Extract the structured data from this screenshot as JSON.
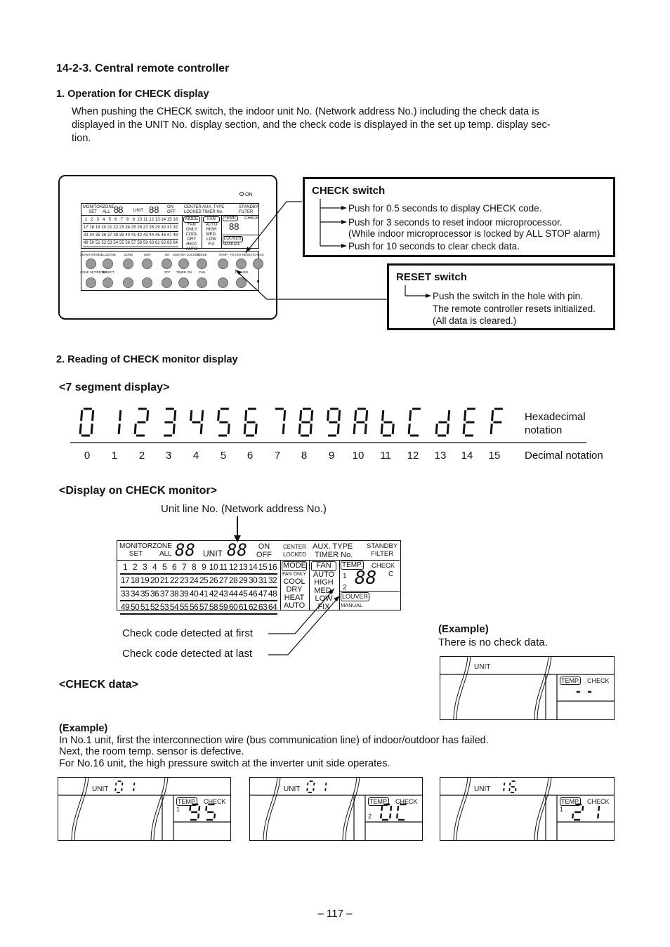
{
  "section_title": "14-2-3.  Central remote controller",
  "sub1": {
    "title": "1.  Operation for CHECK display",
    "body_line1": "When pushing the CHECK switch, the indoor unit No. (Network address No.) including the check data is",
    "body_line2": "displayed in the UNIT No. display section, and the check code is displayed in the set up temp. display sec-",
    "body_line3": "tion."
  },
  "controller": {
    "on_label": "ON",
    "lcd": {
      "monitor": "MONITOR",
      "set": "SET",
      "zone": "ZONE",
      "all": "ALL",
      "unit": "UNIT",
      "on": "ON",
      "off": "OFF",
      "center": "CENTER",
      "locked": "LOCKED",
      "aux_type": "AUX. TYPE",
      "timer_no": "TIMER No.",
      "standby": "STANDBY",
      "filter": "FILTER",
      "mode": "MODE",
      "fan_only": "FAN ONLY",
      "cool": "COOL",
      "dry": "DRY",
      "heat": "HEAT",
      "auto": "AUTO",
      "fan": "FAN",
      "fan_auto": "AUTO",
      "high": "HIGH",
      "med": "MED.",
      "low": "LOW",
      "fix": "FIX",
      "temp": "TEMP.",
      "check": "CHECK",
      "c": "C",
      "row1": "1",
      "row2": "2",
      "louver": "LOUVER",
      "manual": "MANUAL",
      "digits_placeholder": "88"
    },
    "buttons_top": [
      "MONITOR/SET",
      "ALL/ZONE",
      "ZONE",
      "UNIT",
      "ON",
      "CENTER LOCKED",
      "MODE",
      "TEMP.",
      "FILTER RESET",
      "CHECK"
    ],
    "buttons_bottom": [
      "ZONE SET/ENTER",
      "SELECT",
      "",
      "",
      "OFF",
      "TIMER ON",
      "FAN",
      "",
      "LOUVER",
      ""
    ]
  },
  "check_switch": {
    "title": "CHECK switch",
    "items": [
      "Push for 0.5 seconds to display CHECK code.",
      "Push for 3 seconds to reset indoor microprocessor.",
      "(While indoor microprocessor is locked by ALL STOP alarm)",
      "Push for 10 seconds to clear check data."
    ]
  },
  "reset_switch": {
    "title": "RESET switch",
    "lines": [
      "Push the switch in the hole with pin.",
      "The remote controller resets initialized.",
      "(All data is cleared.)"
    ]
  },
  "sub2": {
    "title": "2.  Reading of CHECK monitor display"
  },
  "seven_segment": {
    "heading": "<7 segment display>",
    "hex_label_1": "Hexadecimal",
    "hex_label_2": "notation",
    "decimal_label": "Decimal notation",
    "hex": [
      "0",
      "1",
      "2",
      "3",
      "4",
      "5",
      "6",
      "7",
      "8",
      "9",
      "A",
      "b",
      "C",
      "d",
      "E",
      "F"
    ],
    "decimal": [
      "0",
      "1",
      "2",
      "3",
      "4",
      "5",
      "6",
      "7",
      "8",
      "9",
      "10",
      "11",
      "12",
      "13",
      "14",
      "15"
    ]
  },
  "check_monitor": {
    "heading": "<Display on CHECK monitor>",
    "unit_line_label": "Unit line No. (Network address No.)",
    "first_label": "Check code detected at first",
    "last_label": "Check code detected at last",
    "unit_grid": [
      [
        "1",
        "2",
        "3",
        "4",
        "5",
        "6",
        "7",
        "8",
        "9",
        "10",
        "11",
        "12",
        "13",
        "14",
        "15",
        "16"
      ],
      [
        "17",
        "18",
        "19",
        "20",
        "21",
        "22",
        "23",
        "24",
        "25",
        "26",
        "27",
        "28",
        "29",
        "30",
        "31",
        "32"
      ],
      [
        "33",
        "34",
        "35",
        "36",
        "37",
        "38",
        "39",
        "40",
        "41",
        "42",
        "43",
        "44",
        "45",
        "46",
        "47",
        "48"
      ],
      [
        "49",
        "50",
        "51",
        "52",
        "53",
        "54",
        "55",
        "56",
        "57",
        "58",
        "59",
        "60",
        "61",
        "62",
        "63",
        "64"
      ]
    ]
  },
  "check_data": {
    "heading": "<CHECK data>"
  },
  "example_no_data": {
    "title": "(Example)",
    "text": "There is no check data.",
    "unit_label": "UNIT",
    "temp": "TEMP.",
    "check": "CHECK",
    "code": "- -"
  },
  "example_main": {
    "title": "(Example)",
    "line1": "In No.1 unit, first the interconnection wire (bus communication line) of indoor/outdoor has failed.",
    "line2": "Next, the room temp. sensor is defective.",
    "line3": "For No.16 unit, the high pressure switch at the inverter unit side operates.",
    "panels": [
      {
        "unit_label": "UNIT",
        "unit_no": "01",
        "temp": "TEMP.",
        "check": "CHECK",
        "index": "1",
        "code": "95"
      },
      {
        "unit_label": "UNIT",
        "unit_no": "01",
        "temp": "TEMP.",
        "check": "CHECK",
        "index": "2",
        "code": "0C"
      },
      {
        "unit_label": "UNIT",
        "unit_no": "16",
        "temp": "TEMP.",
        "check": "CHECK",
        "index": "1",
        "code": "21"
      }
    ]
  },
  "page_number": "– 117 –"
}
